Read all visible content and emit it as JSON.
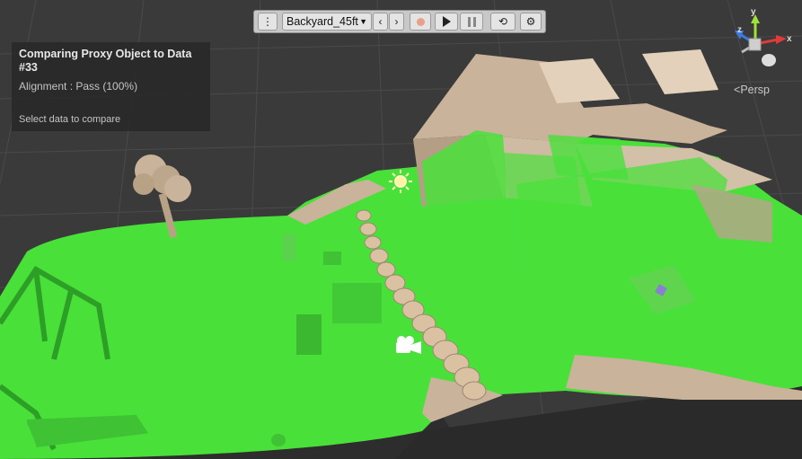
{
  "toolbar": {
    "more_icon": "vertical-ellipsis-icon",
    "scene_name": "Backyard_45ft",
    "prev_icon": "chevron-left-icon",
    "next_icon": "chevron-right-icon",
    "record_icon": "record-icon",
    "play_icon": "play-icon",
    "pause_icon": "pause-icon",
    "loop_icon": "loop-icon",
    "settings_icon": "gear-icon"
  },
  "info": {
    "title": "Comparing Proxy Object to Data #33",
    "alignment": "Alignment : Pass (100%)",
    "hint": "Select data to compare"
  },
  "gizmo": {
    "y_label": "y",
    "x_label": "x",
    "z_label": "z",
    "projection": "Persp"
  },
  "colors": {
    "grid_background": "#3a3a3a",
    "proxy_green": "#49e03a",
    "house_beige": "#c9b39a",
    "panel_background": "#282828"
  }
}
